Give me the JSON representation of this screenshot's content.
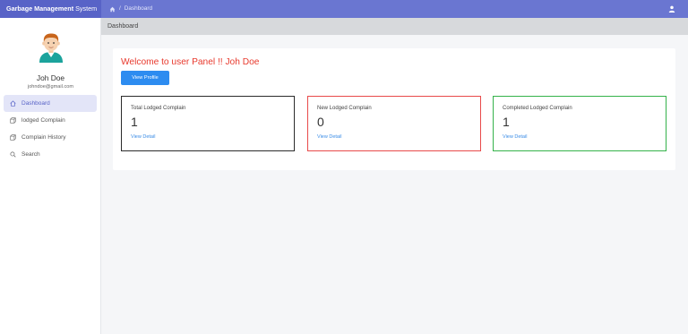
{
  "app": {
    "brand_bold": "Garbage Management",
    "brand_light": "System",
    "breadcrumb": "Dashboard"
  },
  "user": {
    "name": "Joh Doe",
    "email": "johndoe@gmail.com"
  },
  "sidebar": {
    "items": [
      {
        "label": "Dashboard",
        "icon": "home-icon",
        "active": true
      },
      {
        "label": "lodged Complain",
        "icon": "box-icon",
        "active": false
      },
      {
        "label": "Complain History",
        "icon": "box-icon",
        "active": false
      },
      {
        "label": "Search",
        "icon": "search-icon",
        "active": false
      }
    ]
  },
  "page": {
    "title": "Dashboard"
  },
  "main": {
    "welcome": "Welcome to user Panel !! Joh Doe",
    "view_profile": "View Profile",
    "stats": [
      {
        "title": "Total Lodged Complain",
        "value": "1",
        "link": "View Detail",
        "color": "#2b2b2b"
      },
      {
        "title": "New Lodged Complain",
        "value": "0",
        "link": "View Detail",
        "color": "#e84a4a"
      },
      {
        "title": "Completed Lodged Complain",
        "value": "1",
        "link": "View Detail",
        "color": "#34b24a"
      }
    ]
  },
  "colors": {
    "topbar": "#6a76d1",
    "brand_bg": "#5863c7",
    "primary_button": "#2d8cf0",
    "welcome_text": "#e8392d",
    "link": "#3a8ce6"
  }
}
